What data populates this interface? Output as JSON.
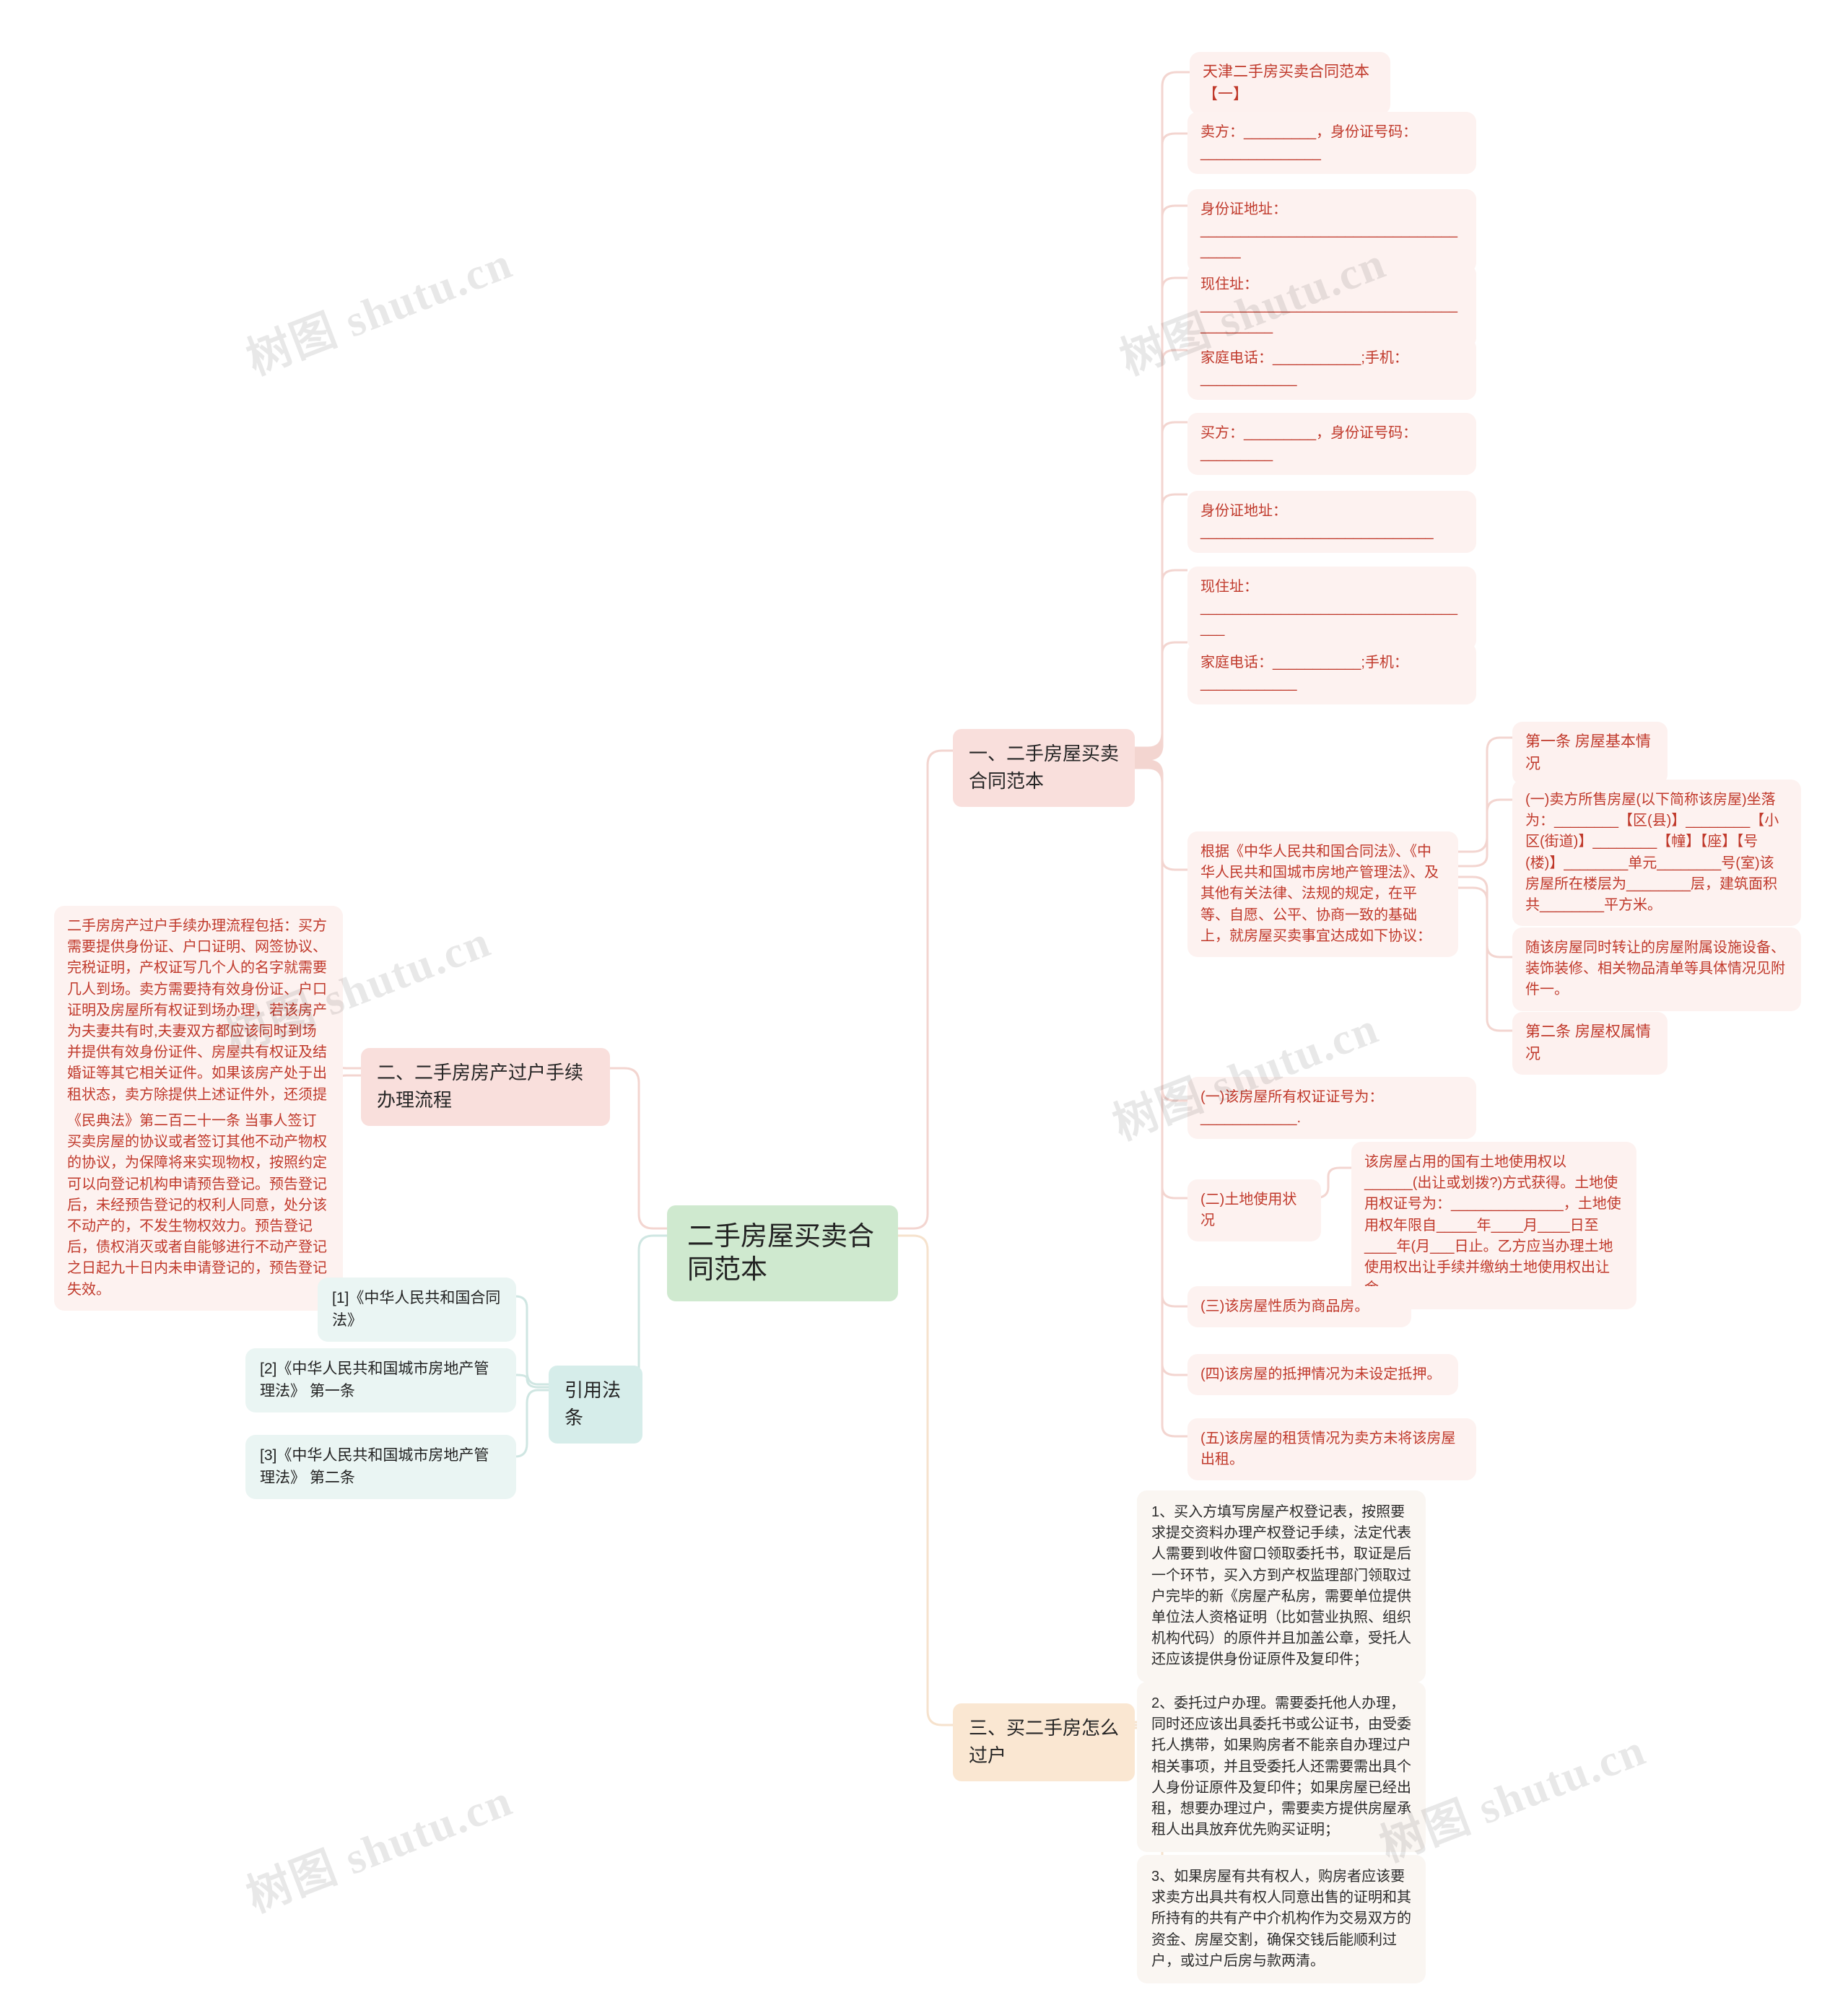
{
  "app": {
    "watermark_text": "树图 shutu.cn",
    "canvas_background": "#ffffff"
  },
  "colors": {
    "root_fill": "#cfe9cf",
    "branch_pink_fill": "#f9dfdc",
    "branch_orange_fill": "#fae7d2",
    "branch_teal_fill": "#d6edea",
    "leaf_red_fill": "#fdf2f0",
    "leaf_red_text": "#c0392b",
    "leaf_dark_fill": "#faf6f2",
    "leaf_cite_fill": "#eaf5f3",
    "edge_pink": "#f3d5d0",
    "edge_teal": "#cfe6e2",
    "edge_orange": "#f6e2cd"
  },
  "root": {
    "label": "二手房屋买卖合同范本"
  },
  "branches": [
    {
      "id": "b1",
      "label": "一、二手房屋买卖合同范本"
    },
    {
      "id": "b2",
      "label": "二、二手房房产过户手续办理流程"
    },
    {
      "id": "b3",
      "label": "三、买二手房怎么过户"
    },
    {
      "id": "b4",
      "label": "引用法条"
    }
  ],
  "contract_template": {
    "title": "天津二手房买卖合同范本【一】",
    "parties": [
      "卖方：_________，身份证号码：_______________",
      "身份证地址：_____________________________________",
      "现住址：_________________________________________",
      "家庭电话：___________;手机：____________",
      "买方：_________，身份证号码：_________",
      "身份证地址：_____________________________",
      "现住址：___________________________________",
      "家庭电话：___________;手机：____________"
    ],
    "preamble": "根据《中华人民共和国合同法》、《中华人民共和国城市房地产管理法》、及其他有关法律、法规的规定，在平等、自愿、公平、协商一致的基础上，就房屋买卖事宜达成如下协议："
  },
  "article_one": {
    "heading": "第一条 房屋基本情况",
    "items": [
      "(一)卖方所售房屋(以下简称该房屋)坐落为：________【区(县)】________【小区(街道)】________【幢】【座】【号(楼)】________单元________号(室)该房屋所在楼层为________层，建筑面积共________平方米。",
      "随该房屋同时转让的房屋附属设施设备、装饰装修、相关物品清单等具体情况见附件一。"
    ]
  },
  "article_two": {
    "heading": "第二条 房屋权属情况",
    "items": [
      "(一)该房屋所有权证证号为：____________.",
      "(二)土地使用状况",
      "(三)该房屋性质为商品房。",
      "(四)该房屋的抵押情况为未设定抵押。",
      "(五)该房屋的租赁情况为卖方未将该房屋出租。"
    ],
    "land_use_detail": "该房屋占用的国有土地使用权以______(出让或划拨?)方式获得。土地使用权证号为：______________，土地使用权年限自_____年____月____日至____年(月___日止。乙方应当办理土地使用权出让手续并缴纳土地使用权出让金。"
  },
  "transfer_flow": {
    "summary": "二手房房产过户手续办理流程包括：买方需要提供身份证、户口证明、网签协议、完税证明，产权证写几个人的名字就需要几人到场。卖方需要持有效身份证、户口证明及房屋所有权证到场办理，若该房产为夫妻共有时,夫妻双方都应该同时到场并提供有效身份证件、房屋共有权证及结婚证等其它相关证件。如果该房产处于出租状态，卖方除提供上述证件外，还须提供承租人放弃优先购买的书面材料。",
    "law_note": "《民典法》第二百二十一条 当事人签订买卖房屋的协议或者签订其他不动产物权的协议，为保障将来实现物权，按照约定可以向登记机构申请预告登记。预告登记后，未经预告登记的权利人同意，处分该不动产的，不发生物权效力。预告登记后，债权消灭或者自能够进行不动产登记之日起九十日内未申请登记的，预告登记失效。"
  },
  "how_to_transfer": {
    "steps": [
      "1、买入方填写房屋产权登记表，按照要求提交资料办理产权登记手续，法定代表人需要到收件窗口领取委托书，取证是后一个环节，买入方到产权监理部门领取过户完毕的新《房屋产私房，需要单位提供单位法人资格证明（比如营业执照、组织机构代码）的原件并且加盖公章，受托人还应该提供身份证原件及复印件；",
      "2、委托过户办理。需要委托他人办理，同时还应该出具委托书或公证书，由受委托人携带，如果购房者不能亲自办理过户相关事项，并且受委托人还需要需出具个人身份证原件及复印件；如果房屋已经出租，想要办理过户，需要卖方提供房屋承租人出具放弃优先购买证明；",
      "3、如果房屋有共有权人，购房者应该要求卖方出具共有权人同意出售的证明和其所持有的共有产中介机构作为交易双方的资金、房屋交割，确保交钱后能顺利过户，或过户后房与款两清。"
    ]
  },
  "citations": [
    "[1]《中华人民共和国合同法》",
    "[2]《中华人民共和国城市房地产管理法》 第一条",
    "[3]《中华人民共和国城市房地产管理法》 第二条"
  ]
}
